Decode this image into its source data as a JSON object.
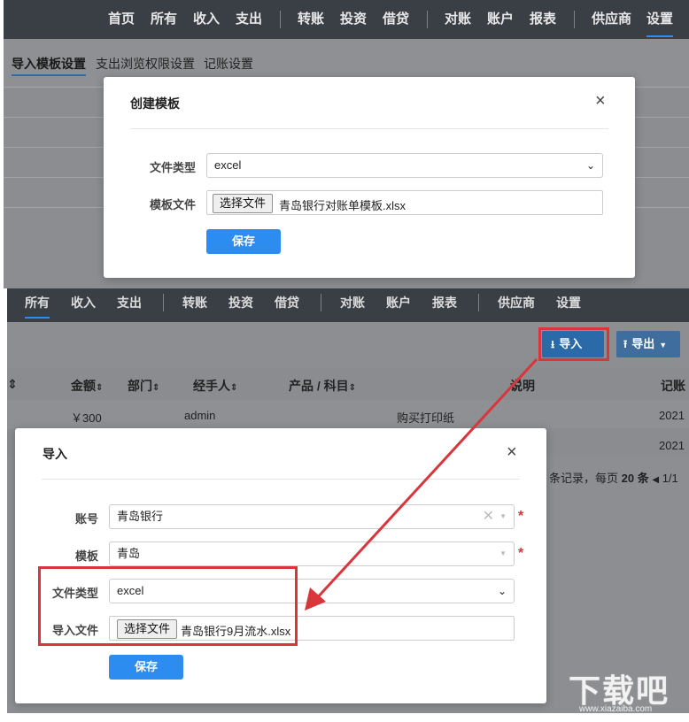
{
  "top_nav": {
    "items": [
      "首页",
      "所有",
      "收入",
      "支出",
      "转账",
      "投资",
      "借贷",
      "对账",
      "账户",
      "报表",
      "供应商",
      "设置"
    ],
    "active": "设置"
  },
  "sub_nav": {
    "items": [
      "导入模板设置",
      "支出浏览权限设置",
      "记账设置"
    ],
    "active": "导入模板设置"
  },
  "create_modal": {
    "title": "创建模板",
    "close": "×",
    "file_type_label": "文件类型",
    "file_type_value": "excel",
    "template_file_label": "模板文件",
    "choose_file": "选择文件",
    "file_name": "青岛银行对账单模板.xlsx",
    "save": "保存"
  },
  "bottom_nav": {
    "items": [
      "所有",
      "收入",
      "支出",
      "转账",
      "投资",
      "借贷",
      "对账",
      "账户",
      "报表",
      "供应商",
      "设置"
    ],
    "active": "所有"
  },
  "toolbar": {
    "import_label": "导入",
    "export_label": "导出"
  },
  "table": {
    "headers": [
      "金额",
      "部门",
      "经手人",
      "产品 / 科目",
      "说明",
      "记账"
    ],
    "rows": [
      {
        "amount": "￥300",
        "handler": "admin",
        "desc": "购买打印纸",
        "date": "2021"
      },
      {
        "date": "2021"
      }
    ],
    "pager": "条记录，每页",
    "page_size": "20",
    "pager_unit": "条",
    "page_info": "1/1"
  },
  "import_modal": {
    "title": "导入",
    "close": "×",
    "account_label": "账号",
    "account_value": "青岛银行",
    "template_label": "模板",
    "template_value": "青岛",
    "file_type_label": "文件类型",
    "file_type_value": "excel",
    "import_file_label": "导入文件",
    "choose_file": "选择文件",
    "file_name": "青岛银行9月流水.xlsx",
    "save": "保存",
    "required_mark": "*"
  },
  "watermark": {
    "text": "下载吧",
    "url": "www.xiazaiba.com"
  },
  "colors": {
    "accent": "#2d8cf0",
    "nav_bg": "#3a3e45",
    "highlight": "#d9353b"
  }
}
